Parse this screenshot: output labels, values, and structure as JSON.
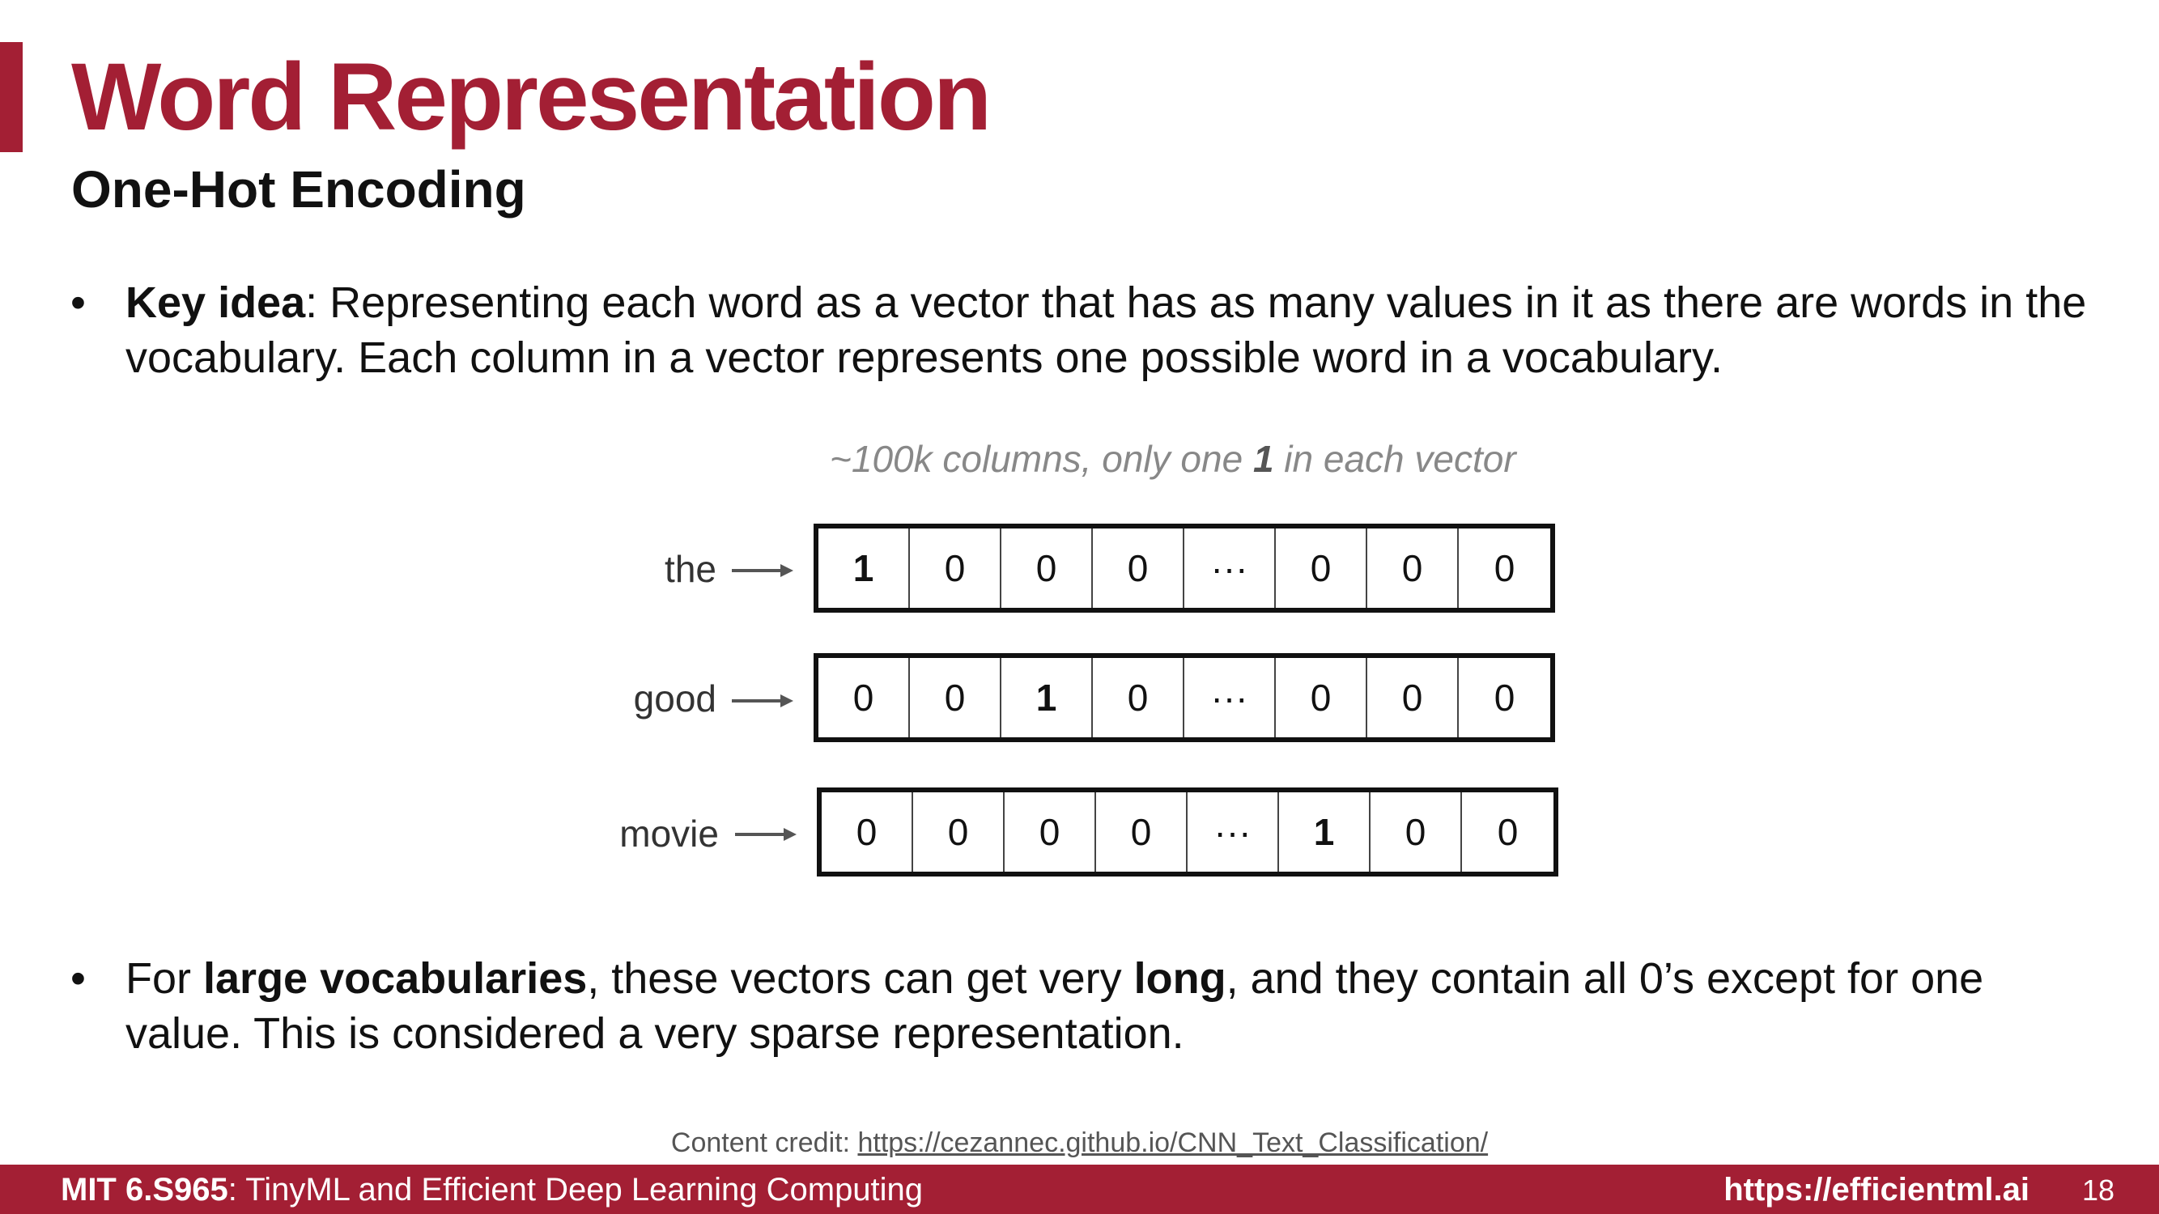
{
  "slide": {
    "title": "Word Representation",
    "subtitle": "One-Hot Encoding"
  },
  "bullet1": {
    "bold": "Key idea",
    "text": ": Representing each word as a vector that has as many values in it as there are words in the vocabulary. Each column in a vector represents one possible word in a vocabulary."
  },
  "diagram": {
    "caption_pre": "~100k columns, only one ",
    "caption_bold": "1",
    "caption_post": " in each vector",
    "rows": [
      {
        "word": "the",
        "cells": [
          "1",
          "0",
          "0",
          "0",
          "···",
          "0",
          "0",
          "0"
        ],
        "hot": 0
      },
      {
        "word": "good",
        "cells": [
          "0",
          "0",
          "1",
          "0",
          "···",
          "0",
          "0",
          "0"
        ],
        "hot": 2
      },
      {
        "word": "movie",
        "cells": [
          "0",
          "0",
          "0",
          "0",
          "···",
          "1",
          "0",
          "0"
        ],
        "hot": 5
      }
    ]
  },
  "bullet2": {
    "t1": "For ",
    "b1": "large vocabularies",
    "t2": ", these vectors can get very ",
    "b2": "long",
    "t3": ", and they contain all 0’s except for one value. This is considered a very sparse representation."
  },
  "credit": {
    "label": "Content credit: ",
    "link": "https://cezannec.github.io/CNN_Text_Classification/"
  },
  "footer": {
    "course_bold": "MIT 6.S965",
    "course_rest": ": TinyML and Efficient Deep Learning Computing",
    "url": "https://efficientml.ai",
    "page": "18"
  },
  "colors": {
    "accent": "#a31f34"
  }
}
